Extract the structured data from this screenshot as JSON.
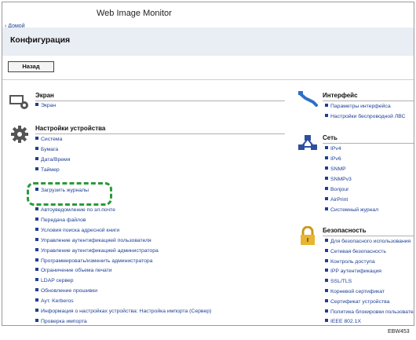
{
  "app": {
    "title": "Web Image Monitor",
    "home_link": "‹ Домой"
  },
  "page": {
    "title": "Конфигурация",
    "back_label": "Назад"
  },
  "sections": {
    "screen": {
      "title": "Экран",
      "icon": "monitor-gear-icon",
      "items": [
        "Экран"
      ]
    },
    "device": {
      "title": "Настройки устройства",
      "icon": "gear-icon",
      "items_a": [
        "Система",
        "Бумага",
        "Дата/Время",
        "Таймер"
      ],
      "highlighted": "Загрузить журналы",
      "items_b": [
        "Автоуведомление по эл.почте",
        "Передача файлов",
        "Условия поиска адресной книги",
        "Управление аутентификацией пользователя",
        "Управление аутентификацией администратора",
        "Программировать/изменить администратора",
        "Ограничение объема печати",
        "LDAP сервер",
        "Обновление прошивки",
        "Aут. Kerberos",
        "Информация о настройках устройства: Настройка импорта (Сервер)",
        "Проверка импорта"
      ]
    },
    "interface": {
      "title": "Интерфейс",
      "icon": "cable-icon",
      "items": [
        "Параметры интерфейса",
        "Настройки беспроводной ЛВС"
      ]
    },
    "network": {
      "title": "Сеть",
      "icon": "network-icon",
      "items": [
        "IPv4",
        "IPv6",
        "SNMP",
        "SNMPv3",
        "Bonjour",
        "AirPrint",
        "Системный журнал"
      ]
    },
    "security": {
      "title": "Безопасность",
      "icon": "padlock-icon",
      "items": [
        "Для безопасного использования",
        "Сетевая безопасность",
        "Контроль доступа",
        "IPP аутентификация",
        "SSL/TLS",
        "Корневой сертификат",
        "Сертификат устройства",
        "Политика блокировки пользователей",
        "IEEE 802.1X"
      ]
    }
  },
  "figure_code": "EBW453",
  "colors": {
    "link": "#1c3f94",
    "highlight": "#2a9a3a",
    "header": "#e9eef5"
  }
}
